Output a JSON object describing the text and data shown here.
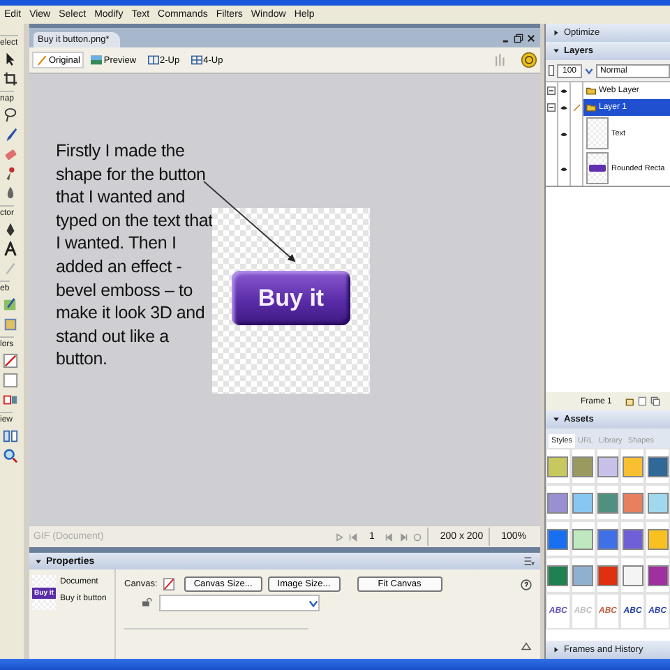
{
  "menu": [
    "Edit",
    "View",
    "Select",
    "Modify",
    "Text",
    "Commands",
    "Filters",
    "Window",
    "Help"
  ],
  "tools": {
    "sections": [
      "elect",
      "nap",
      "ctor",
      "eb",
      "lors",
      "iew"
    ]
  },
  "document": {
    "tab": "Buy it button.png*",
    "views": [
      {
        "label": "Original",
        "selected": true
      },
      {
        "label": "Preview",
        "selected": false
      },
      {
        "label": "2-Up",
        "selected": false
      },
      {
        "label": "4-Up",
        "selected": false
      }
    ],
    "note": "Firstly I made the shape for the button that I wanted and typed on the text that I wanted. Then I added an effect - bevel emboss – to make it look 3D and stand out like a button.",
    "button_text": "Buy it",
    "status": {
      "format": "GIF (Document)",
      "frame": "1",
      "size": "200 x 200",
      "zoom": "100%"
    }
  },
  "properties": {
    "title": "Properties",
    "object": "Document",
    "name": "Buy it button",
    "thumb_text": "Buy it",
    "canvas_label": "Canvas:",
    "buttons": [
      "Canvas Size...",
      "Image Size...",
      "Fit Canvas"
    ]
  },
  "panels": {
    "optimize": "Optimize",
    "layers": "Layers",
    "opacity": "100",
    "blend": "Normal",
    "layer_list": [
      {
        "name": "Web Layer",
        "kind": "layer",
        "selected": false
      },
      {
        "name": "Layer 1",
        "kind": "layer",
        "selected": true
      },
      {
        "name": "Text",
        "kind": "object",
        "selected": false
      },
      {
        "name": "Rounded Recta",
        "kind": "object",
        "selected": false
      }
    ],
    "frame": "Frame 1",
    "assets": "Assets",
    "asset_tabs": [
      {
        "label": "Styles",
        "selected": true
      },
      {
        "label": "URL",
        "selected": false
      },
      {
        "label": "Library",
        "selected": false
      },
      {
        "label": "Shapes",
        "selected": false
      }
    ],
    "styles": [
      {
        "color": "#c8c860"
      },
      {
        "color": "#9a9a60"
      },
      {
        "color": "#c8c0e8"
      },
      {
        "color": "#f8c030"
      },
      {
        "color": "#306898"
      },
      {
        "color": "#9890d0"
      },
      {
        "color": "#88c8f0"
      },
      {
        "color": "#509080"
      },
      {
        "color": "#e88060"
      },
      {
        "color": "#a0d8f0"
      },
      {
        "color": "#1870f0"
      },
      {
        "color": "#c0e8c0"
      },
      {
        "color": "#4070e8"
      },
      {
        "color": "#7060d8"
      },
      {
        "color": "#f8c020"
      },
      {
        "color": "#208050"
      },
      {
        "color": "#90b0d0"
      },
      {
        "color": "#e03010"
      },
      {
        "color": "#f4f4f4"
      },
      {
        "color": "#a030a0"
      }
    ],
    "text_styles": [
      {
        "text": "ABC",
        "color": "#6050c0"
      },
      {
        "text": "ABC",
        "color": "#c0c0c0"
      },
      {
        "text": "ABC",
        "color": "#c06040"
      },
      {
        "text": "ABC",
        "color": "#2040a0"
      },
      {
        "text": "ABC",
        "color": "#3040b0"
      }
    ],
    "frames_history": "Frames and History"
  }
}
